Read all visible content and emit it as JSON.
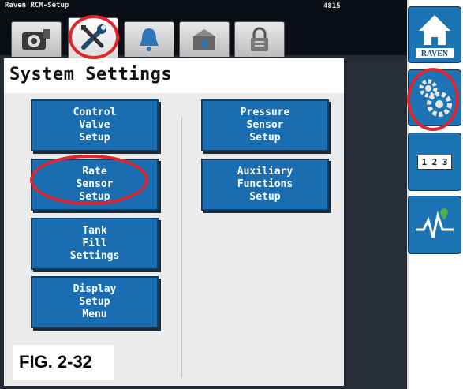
{
  "header": {
    "app_name": "Raven RCM-Setup",
    "counter": "4815"
  },
  "tabs": [
    {
      "name": "machine-settings",
      "icon": "machine-gear-icon"
    },
    {
      "name": "tools",
      "icon": "wrench-screwdriver-icon",
      "active": true
    },
    {
      "name": "alarms",
      "icon": "bell-icon"
    },
    {
      "name": "product",
      "icon": "tank-drop-icon"
    },
    {
      "name": "security",
      "icon": "lock-icon"
    }
  ],
  "page": {
    "title": "System Settings"
  },
  "buttons": {
    "control_valve": "Control\nValve\nSetup",
    "rate_sensor": "Rate\nSensor\nSetup",
    "tank_fill": "Tank\nFill\nSettings",
    "display_setup": "Display\nSetup\nMenu",
    "pressure_sensor": "Pressure\nSensor\nSetup",
    "auxiliary": "Auxiliary\nFunctions\nSetup"
  },
  "side": {
    "home_brand": "RAVEN",
    "numeric_label": "1 2 3"
  },
  "figure_label": "FIG. 2-32",
  "colors": {
    "button_blue": "#1a6db0",
    "highlight_red": "#e0262c",
    "side_blue": "#1d74b4"
  }
}
